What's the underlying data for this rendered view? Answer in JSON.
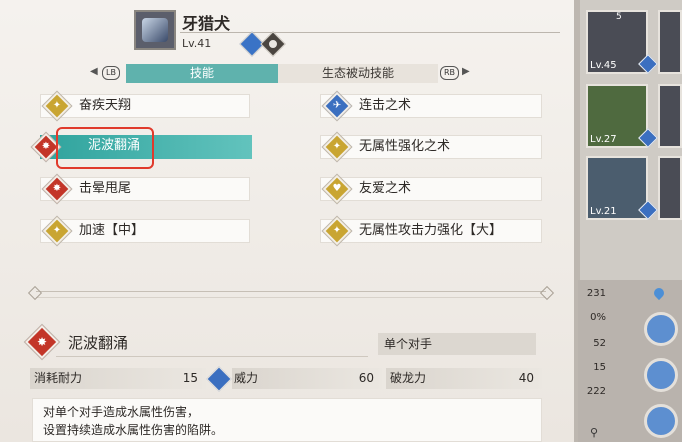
{
  "monster": {
    "name": "牙猎犬",
    "level": "Lv.41"
  },
  "tabs": {
    "left_button": "LB",
    "skill": "技能",
    "eco": "生态被动技能",
    "right_button": "RB",
    "arrow_left": "◀",
    "arrow_right": "▶"
  },
  "skills": {
    "left": [
      {
        "label": "奋疾天翔",
        "icon": "gold-buff-icon"
      },
      {
        "label": "泥波翻涌",
        "icon": "red-attack-icon",
        "selected": true
      },
      {
        "label": "击晕甩尾",
        "icon": "red-attack-icon"
      },
      {
        "label": "加速【中】",
        "icon": "gold-buff-icon"
      }
    ],
    "right": [
      {
        "label": "连击之术",
        "icon": "blue-technical-icon"
      },
      {
        "label": "无属性强化之术",
        "icon": "gold-buff-icon"
      },
      {
        "label": "友爱之术",
        "icon": "gold-heart-icon"
      },
      {
        "label": "无属性攻击力强化【大】",
        "icon": "gold-buff-icon"
      }
    ]
  },
  "detail": {
    "name": "泥波翻涌",
    "target": "单个对手",
    "cost_label": "消耗耐力",
    "cost_value": "15",
    "power_label": "威力",
    "power_value": "60",
    "break_label": "破龙力",
    "break_value": "40",
    "description_line1": "对单个对手造成水属性伤害，",
    "description_line2": "设置持续造成水属性伤害的陷阱。"
  },
  "party": {
    "cards": [
      {
        "level": "Lv.45",
        "count": "5"
      },
      {
        "level": "Lv.27"
      },
      {
        "level": "Lv.21"
      }
    ],
    "stats": [
      "231",
      "0%",
      "52",
      "15",
      "222"
    ]
  },
  "colors": {
    "accent": "#5fb2ad",
    "selected": "#2fa39d",
    "highlight": "#e03a2c",
    "gold": "#c9a532",
    "red": "#c33528",
    "blue": "#3b6fc0"
  }
}
